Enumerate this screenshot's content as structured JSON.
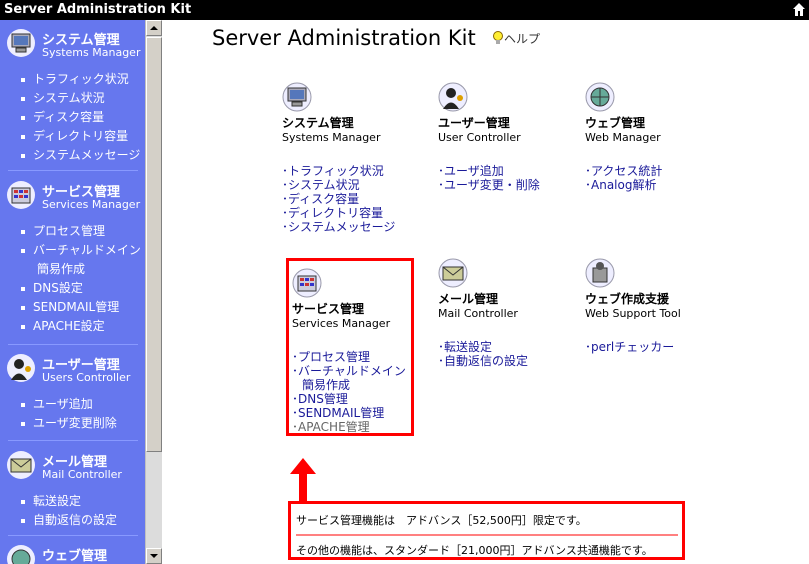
{
  "titlebar": {
    "title": "Server Administration Kit"
  },
  "sidebar": {
    "sections": [
      {
        "jp": "システム管理",
        "en": "Systems Manager",
        "items": [
          "トラフィック状況",
          "システム状況",
          "ディスク容量",
          "ディレクトリ容量",
          "システムメッセージ"
        ]
      },
      {
        "jp": "サービス管理",
        "en": "Services Manager",
        "items": [
          "プロセス管理",
          "バーチャルドメイン",
          "簡易作成",
          "DNS設定",
          "SENDMAIL管理",
          "APACHE設定"
        ]
      },
      {
        "jp": "ユーザー管理",
        "en": "Users Controller",
        "items": [
          "ユーザ追加",
          "ユーザ変更削除"
        ]
      },
      {
        "jp": "メール管理",
        "en": "Mail Controller",
        "items": [
          "転送設定",
          "自動返信の設定"
        ]
      },
      {
        "jp": "ウェブ管理",
        "en": ""
      }
    ]
  },
  "main": {
    "title": "Server Administration Kit",
    "help": "ヘルプ",
    "cards": [
      {
        "jp": "システム管理",
        "en": "Systems Manager",
        "links": [
          "トラフィック状況",
          "システム状況",
          "ディスク容量",
          "ディレクトリ容量",
          "システムメッセージ"
        ]
      },
      {
        "jp": "ユーザー管理",
        "en": "User Controller",
        "links": [
          "ユーザ追加",
          "ユーザ変更・削除"
        ]
      },
      {
        "jp": "ウェブ管理",
        "en": "Web Manager",
        "links": [
          "アクセス統計",
          "Analog解析"
        ]
      },
      {
        "jp": "サービス管理",
        "en": "Services Manager",
        "links": [
          "プロセス管理",
          "バーチャルドメイン",
          "簡易作成",
          "DNS管理",
          "SENDMAIL管理",
          "APACHE管理"
        ]
      },
      {
        "jp": "メール管理",
        "en": "Mail Controller",
        "links": [
          "転送設定",
          "自動返信の設定"
        ]
      },
      {
        "jp": "ウェブ作成支援",
        "en": "Web Support Tool",
        "links": [
          "perlチェッカー"
        ]
      }
    ],
    "notice": {
      "line1": "サービス管理機能は　アドバンス［52,500円］限定です。",
      "line2": "その他の機能は、スタンダード［21,000円］アドバンス共通機能です。"
    }
  },
  "colors": {
    "sidebar_bg": "#6677ee",
    "highlight": "#ff0000",
    "link": "#1a1a99"
  }
}
